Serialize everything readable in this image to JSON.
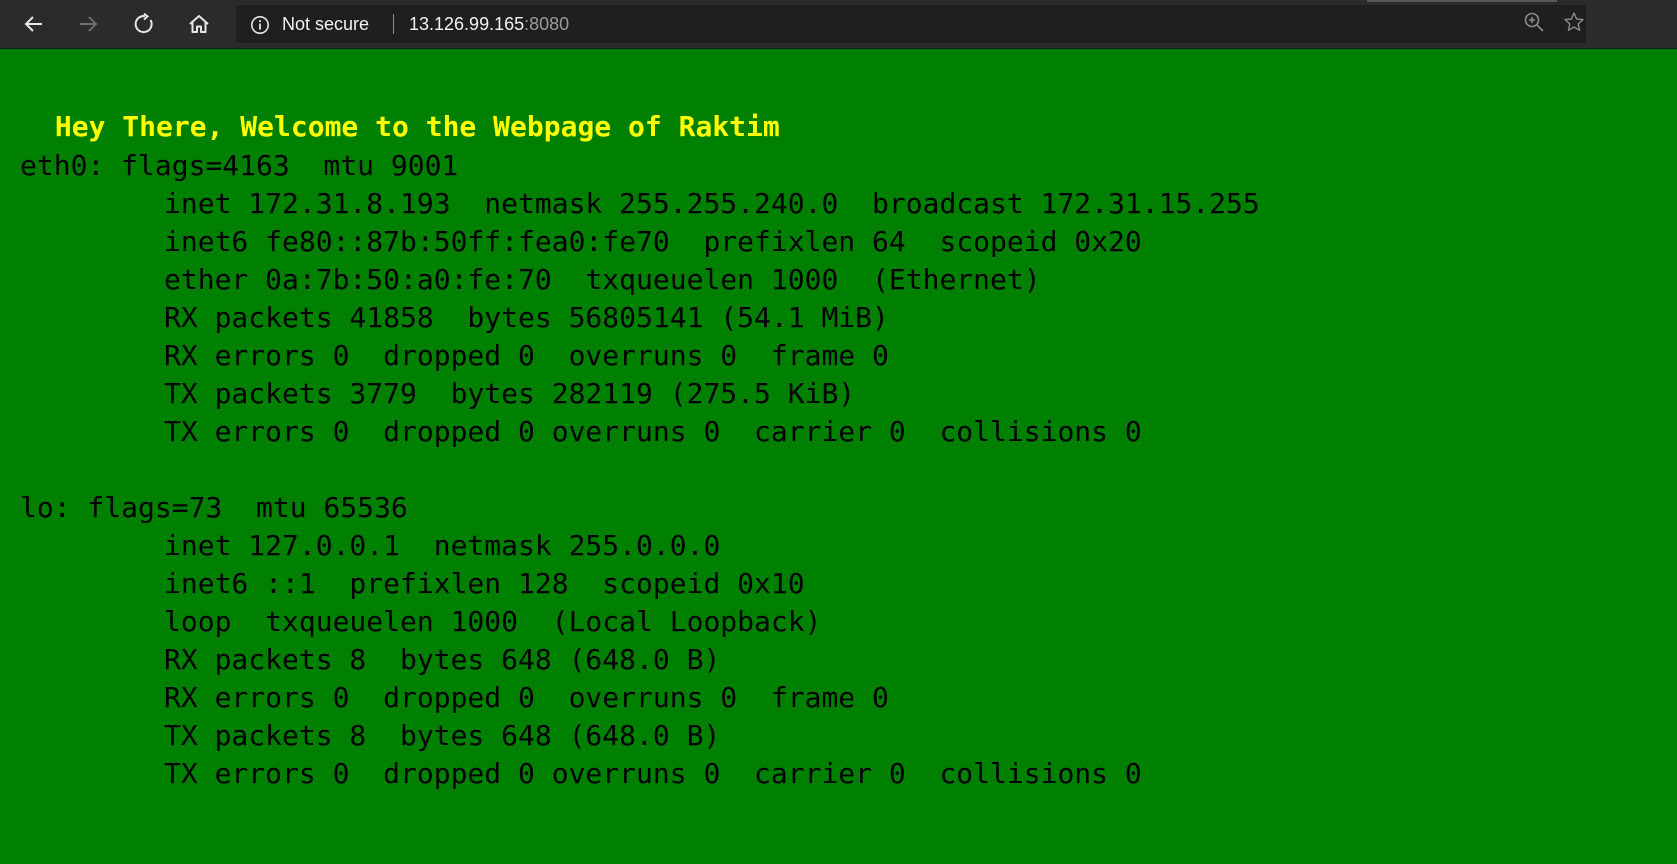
{
  "browser": {
    "security_label": "Not secure",
    "url_host": "13.126.99.165",
    "url_port": ":8080"
  },
  "page": {
    "heading": " Hey There, Welcome to the Webpage of Raktim",
    "eth0": {
      "header": "eth0: flags=4163  mtu 9001",
      "lines": [
        "inet 172.31.8.193  netmask 255.255.240.0  broadcast 172.31.15.255",
        "inet6 fe80::87b:50ff:fea0:fe70  prefixlen 64  scopeid 0x20",
        "ether 0a:7b:50:a0:fe:70  txqueuelen 1000  (Ethernet)",
        "RX packets 41858  bytes 56805141 (54.1 MiB)",
        "RX errors 0  dropped 0  overruns 0  frame 0",
        "TX packets 3779  bytes 282119 (275.5 KiB)",
        "TX errors 0  dropped 0 overruns 0  carrier 0  collisions 0"
      ]
    },
    "lo": {
      "header": "lo: flags=73  mtu 65536",
      "lines": [
        "inet 127.0.0.1  netmask 255.0.0.0",
        "inet6 ::1  prefixlen 128  scopeid 0x10",
        "loop  txqueuelen 1000  (Local Loopback)",
        "RX packets 8  bytes 648 (648.0 B)",
        "RX errors 0  dropped 0  overruns 0  frame 0",
        "TX packets 8  bytes 648 (648.0 B)",
        "TX errors 0  dropped 0 overruns 0  carrier 0  collisions 0"
      ]
    }
  },
  "colors": {
    "page_background": "#008000",
    "heading_text": "#ffff00",
    "terminal_text": "#000000",
    "toolbar_background": "#2b2b2b"
  },
  "icons": {
    "back": "back-arrow-icon",
    "forward": "forward-arrow-icon",
    "refresh": "refresh-icon",
    "home": "home-icon",
    "info": "info-icon",
    "zoom": "zoom-icon",
    "favorite": "star-icon"
  }
}
